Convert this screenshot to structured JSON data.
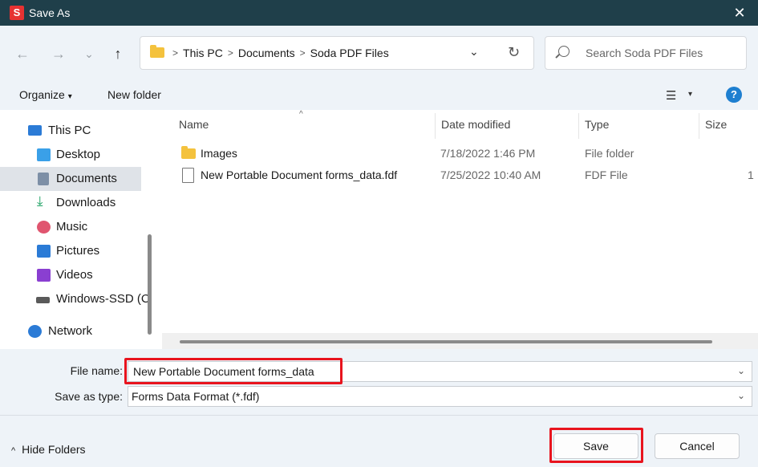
{
  "window": {
    "app_icon_letter": "S",
    "title": "Save As",
    "close_glyph": "✕"
  },
  "nav": {
    "back_glyph": "←",
    "forward_glyph": "→",
    "recent_glyph": "⌄",
    "up_glyph": "↑"
  },
  "address": {
    "crumbs": [
      "This PC",
      "Documents",
      "Soda PDF Files"
    ],
    "separator": ">",
    "dropdown_glyph": "⌄",
    "refresh_glyph": "↻"
  },
  "search": {
    "placeholder": "Search Soda PDF Files"
  },
  "toolbar": {
    "organize_label": "Organize",
    "organize_caret": "▾",
    "new_folder_label": "New folder",
    "view_glyph": "☰",
    "view_caret": "▾",
    "help_glyph": "?"
  },
  "sidebar": {
    "items": [
      {
        "label": "This PC",
        "icon": "computer-icon",
        "color": "#2b7bd6"
      },
      {
        "label": "Desktop",
        "icon": "desktop-icon",
        "color": "#3aa0e8"
      },
      {
        "label": "Documents",
        "icon": "documents-icon",
        "color": "#7d8fa6",
        "selected": true
      },
      {
        "label": "Downloads",
        "icon": "download-icon",
        "color": "#21a366"
      },
      {
        "label": "Music",
        "icon": "music-icon",
        "color": "#e0556f"
      },
      {
        "label": "Pictures",
        "icon": "pictures-icon",
        "color": "#2b7bd6"
      },
      {
        "label": "Videos",
        "icon": "videos-icon",
        "color": "#8a3fd1"
      },
      {
        "label": "Windows-SSD (C",
        "icon": "drive-icon",
        "color": "#5a5a5a"
      },
      {
        "label": "Network",
        "icon": "network-icon",
        "color": "#2b7bd6"
      }
    ]
  },
  "table": {
    "columns": [
      "Name",
      "Date modified",
      "Type",
      "Size"
    ],
    "sort_glyph": "^",
    "rows": [
      {
        "name": "Images",
        "icon": "folder-icon",
        "date": "7/18/2022 1:46 PM",
        "type": "File folder",
        "size": ""
      },
      {
        "name": "New Portable Document forms_data.fdf",
        "icon": "file-icon",
        "date": "7/25/2022 10:40 AM",
        "type": "FDF File",
        "size": "1"
      }
    ]
  },
  "form": {
    "file_name_label": "File name:",
    "file_name_value": "New Portable Document forms_data",
    "save_type_label": "Save as type:",
    "save_type_value": "Forms Data Format (*.fdf)",
    "dropdown_glyph": "⌄",
    "highlight_color": "#e8141e"
  },
  "footer": {
    "hide_folders_caret": "^",
    "hide_folders_label": "Hide Folders",
    "save_label": "Save",
    "cancel_label": "Cancel"
  }
}
